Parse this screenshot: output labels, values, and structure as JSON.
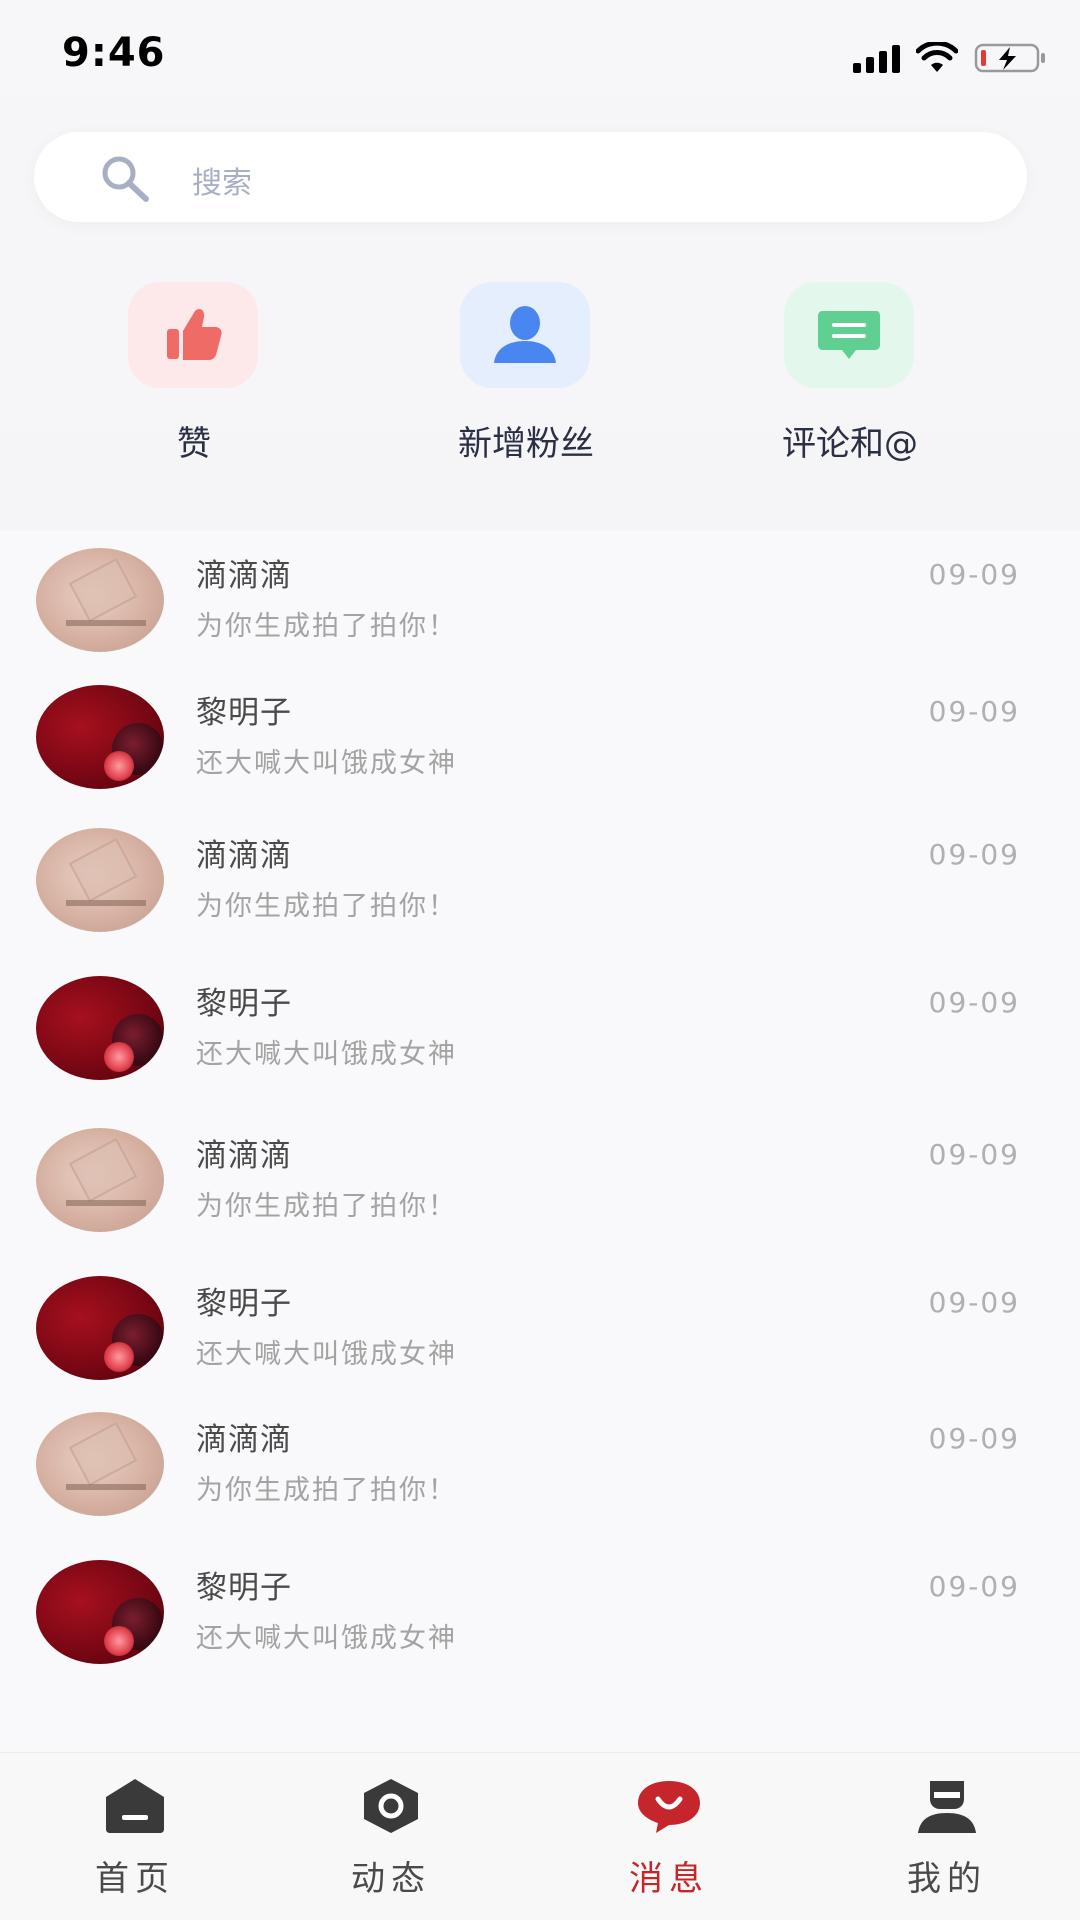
{
  "status_bar": {
    "time": "9:46"
  },
  "search": {
    "placeholder": "搜索"
  },
  "quick_actions": [
    {
      "label": "赞",
      "icon": "thumbs-up-icon",
      "color": "#ee6b66",
      "bg": "#fde9e9"
    },
    {
      "label": "新增粉丝",
      "icon": "user-icon",
      "color": "#4a86f0",
      "bg": "#e5eefd"
    },
    {
      "label": "评论和@",
      "icon": "comment-icon",
      "color": "#5fcf92",
      "bg": "#e4f7ec"
    }
  ],
  "messages": [
    {
      "name": "滴滴滴",
      "text": "为你生成拍了拍你！",
      "date": "09-09",
      "avatar": "light"
    },
    {
      "name": "黎明子",
      "text": "还大喊大叫饿成女神",
      "date": "09-09",
      "avatar": "dark"
    },
    {
      "name": "滴滴滴",
      "text": "为你生成拍了拍你！",
      "date": "09-09",
      "avatar": "light"
    },
    {
      "name": "黎明子",
      "text": "还大喊大叫饿成女神",
      "date": "09-09",
      "avatar": "dark"
    },
    {
      "name": "滴滴滴",
      "text": "为你生成拍了拍你！",
      "date": "09-09",
      "avatar": "light"
    },
    {
      "name": "黎明子",
      "text": "还大喊大叫饿成女神",
      "date": "09-09",
      "avatar": "dark"
    },
    {
      "name": "滴滴滴",
      "text": "为你生成拍了拍你！",
      "date": "09-09",
      "avatar": "light"
    },
    {
      "name": "黎明子",
      "text": "还大喊大叫饿成女神",
      "date": "09-09",
      "avatar": "dark"
    }
  ],
  "tabs": [
    {
      "label": "首页",
      "icon": "home-icon",
      "active": false
    },
    {
      "label": "动态",
      "icon": "moment-icon",
      "active": false
    },
    {
      "label": "消息",
      "icon": "message-icon",
      "active": true
    },
    {
      "label": "我的",
      "icon": "profile-icon",
      "active": false
    }
  ],
  "colors": {
    "accent": "#c4262c",
    "inactive_tab": "#3a3a3a"
  }
}
